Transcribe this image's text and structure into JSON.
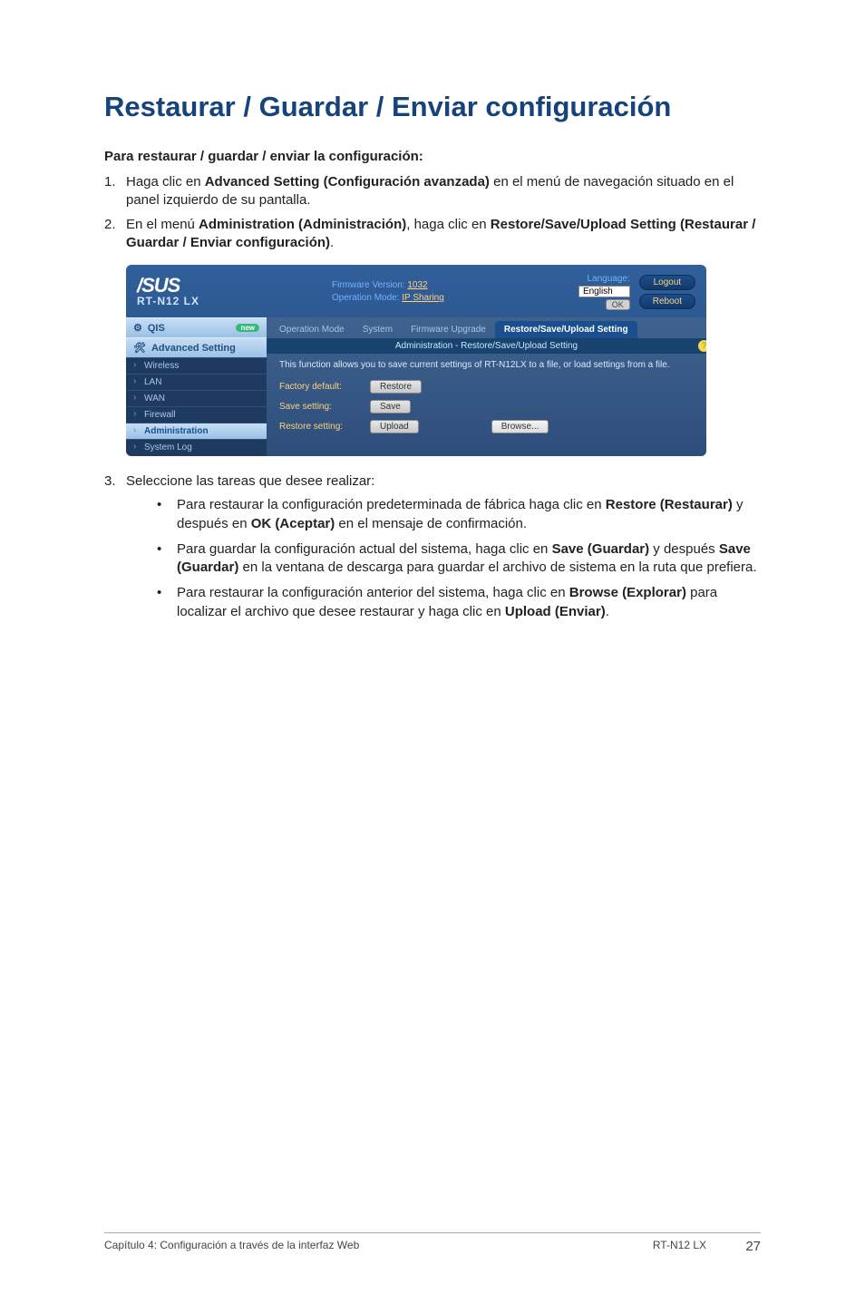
{
  "title": "Restaurar / Guardar / Enviar configuración",
  "subhead": "Para restaurar / guardar / enviar la configuración:",
  "step1_num": "1.",
  "step1_a": "Haga clic en ",
  "step1_b": "Advanced Setting (Configuración avanzada)",
  "step1_c": " en el menú de navegación situado en el panel izquierdo de su pantalla.",
  "step2_num": "2.",
  "step2_a": "En el menú ",
  "step2_b": "Administration (Administración)",
  "step2_c": ", haga clic en ",
  "step2_d": "Restore/Save/Upload Setting (Restaurar / Guardar / Enviar configuración)",
  "step2_e": ".",
  "step3_num": "3.",
  "step3_a": "Seleccione las tareas que desee realizar:",
  "bul1_a": "Para restaurar la configuración predeterminada de fábrica haga clic en ",
  "bul1_b": "Restore (Restaurar)",
  "bul1_c": " y después en ",
  "bul1_d": "OK (Aceptar)",
  "bul1_e": " en el mensaje de confirmación.",
  "bul2_a": "Para guardar la configuración actual del sistema, haga clic en ",
  "bul2_b": "Save (Guardar)",
  "bul2_c": " y después ",
  "bul2_d": "Save (Guardar)",
  "bul2_e": " en la ventana de descarga para guardar el archivo de sistema en la ruta que prefiera.",
  "bul3_a": "Para restaurar la configuración anterior del sistema, haga clic en ",
  "bul3_b": "Browse (Explorar)",
  "bul3_c": " para localizar el archivo que desee restaurar y haga clic en ",
  "bul3_d": "Upload (Enviar)",
  "bul3_e": ".",
  "shot": {
    "brand": "/SUS",
    "model": "RT-N12 LX",
    "fw_label": "Firmware Version:",
    "fw_value": "1032",
    "op_label": "Operation Mode:",
    "op_value": "IP Sharing",
    "lang_label": "Language:",
    "lang_value": "English",
    "ok": "OK",
    "logout": "Logout",
    "reboot": "Reboot",
    "side_qis": "QIS",
    "side_qis_badge": "new",
    "side_adv": "Advanced Setting",
    "side_items": {
      "wireless": "Wireless",
      "lan": "LAN",
      "wan": "WAN",
      "firewall": "Firewall",
      "admin": "Administration",
      "syslog": "System Log"
    },
    "tabs": {
      "op": "Operation Mode",
      "sys": "System",
      "fw": "Firmware Upgrade",
      "rs": "Restore/Save/Upload Setting"
    },
    "panel_title": "Administration - Restore/Save/Upload Setting",
    "desc": "This function allows you to save current settings of  RT-N12LX to a file, or load settings from a file.",
    "rows": {
      "factory_label": "Factory default:",
      "restore_btn": "Restore",
      "save_label": "Save setting:",
      "save_btn": "Save",
      "restore_label": "Restore setting:",
      "upload_btn": "Upload",
      "browse_btn": "Browse..."
    }
  },
  "footer": {
    "left": "Capítulo 4: Configuración a través de la interfaz Web",
    "mid": "RT-N12 LX",
    "page": "27"
  }
}
